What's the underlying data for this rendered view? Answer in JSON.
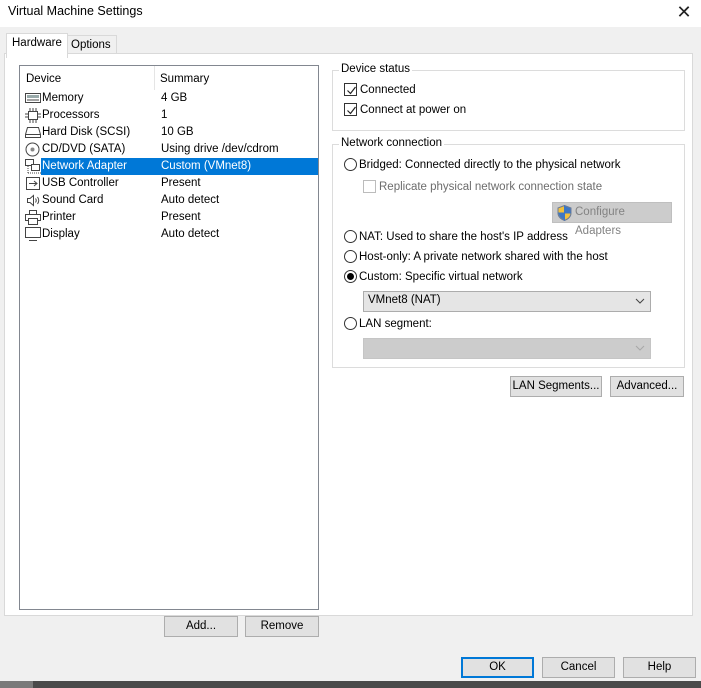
{
  "window": {
    "title": "Virtual Machine Settings",
    "close_icon": "close-icon"
  },
  "tabs": [
    {
      "label": "Hardware",
      "active": true
    },
    {
      "label": "Options",
      "active": false
    }
  ],
  "device_list": {
    "columns": [
      "Device",
      "Summary"
    ],
    "rows": [
      {
        "icon": "memory-icon",
        "device": "Memory",
        "summary": "4 GB",
        "selected": false
      },
      {
        "icon": "processor-icon",
        "device": "Processors",
        "summary": "1",
        "selected": false
      },
      {
        "icon": "hard-disk-icon",
        "device": "Hard Disk (SCSI)",
        "summary": "10 GB",
        "selected": false
      },
      {
        "icon": "cd-dvd-icon",
        "device": "CD/DVD (SATA)",
        "summary": "Using drive /dev/cdrom",
        "selected": false
      },
      {
        "icon": "network-adapter-icon",
        "device": "Network Adapter",
        "summary": "Custom (VMnet8)",
        "selected": true
      },
      {
        "icon": "usb-icon",
        "device": "USB Controller",
        "summary": "Present",
        "selected": false
      },
      {
        "icon": "speaker-icon",
        "device": "Sound Card",
        "summary": "Auto detect",
        "selected": false
      },
      {
        "icon": "printer-icon",
        "device": "Printer",
        "summary": "Present",
        "selected": false
      },
      {
        "icon": "display-icon",
        "device": "Display",
        "summary": "Auto detect",
        "selected": false
      }
    ],
    "add_label": "Add...",
    "remove_label": "Remove"
  },
  "device_status": {
    "legend": "Device status",
    "connected": {
      "label": "Connected",
      "checked": true
    },
    "connect_at_power_on": {
      "label": "Connect at power on",
      "checked": true
    }
  },
  "network_connection": {
    "legend": "Network connection",
    "bridged": {
      "label": "Bridged: Connected directly to the physical network",
      "selected": false
    },
    "replicate": {
      "label": "Replicate physical network connection state",
      "checked": false,
      "disabled": true
    },
    "configure_adapters_label": "Configure Adapters",
    "nat": {
      "label": "NAT: Used to share the host's IP address",
      "selected": false
    },
    "host_only": {
      "label": "Host-only: A private network shared with the host",
      "selected": false
    },
    "custom": {
      "label": "Custom: Specific virtual network",
      "selected": true
    },
    "custom_network_value": "VMnet8 (NAT)",
    "lan_segment": {
      "label": "LAN segment:",
      "selected": false
    },
    "lan_segment_value": ""
  },
  "buttons": {
    "lan_segments": "LAN Segments...",
    "advanced": "Advanced...",
    "ok": "OK",
    "cancel": "Cancel",
    "help": "Help"
  },
  "colors": {
    "selection": "#0078d7",
    "dialog_bg": "#f0f0f0",
    "default_button_border": "#0078d7"
  }
}
